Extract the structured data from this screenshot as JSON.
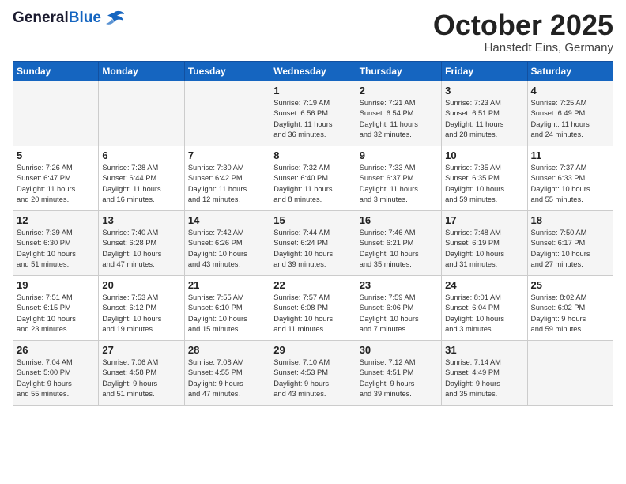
{
  "header": {
    "logo_general": "General",
    "logo_blue": "Blue",
    "month": "October 2025",
    "location": "Hanstedt Eins, Germany"
  },
  "days_of_week": [
    "Sunday",
    "Monday",
    "Tuesday",
    "Wednesday",
    "Thursday",
    "Friday",
    "Saturday"
  ],
  "weeks": [
    [
      {
        "day": "",
        "info": ""
      },
      {
        "day": "",
        "info": ""
      },
      {
        "day": "",
        "info": ""
      },
      {
        "day": "1",
        "info": "Sunrise: 7:19 AM\nSunset: 6:56 PM\nDaylight: 11 hours\nand 36 minutes."
      },
      {
        "day": "2",
        "info": "Sunrise: 7:21 AM\nSunset: 6:54 PM\nDaylight: 11 hours\nand 32 minutes."
      },
      {
        "day": "3",
        "info": "Sunrise: 7:23 AM\nSunset: 6:51 PM\nDaylight: 11 hours\nand 28 minutes."
      },
      {
        "day": "4",
        "info": "Sunrise: 7:25 AM\nSunset: 6:49 PM\nDaylight: 11 hours\nand 24 minutes."
      }
    ],
    [
      {
        "day": "5",
        "info": "Sunrise: 7:26 AM\nSunset: 6:47 PM\nDaylight: 11 hours\nand 20 minutes."
      },
      {
        "day": "6",
        "info": "Sunrise: 7:28 AM\nSunset: 6:44 PM\nDaylight: 11 hours\nand 16 minutes."
      },
      {
        "day": "7",
        "info": "Sunrise: 7:30 AM\nSunset: 6:42 PM\nDaylight: 11 hours\nand 12 minutes."
      },
      {
        "day": "8",
        "info": "Sunrise: 7:32 AM\nSunset: 6:40 PM\nDaylight: 11 hours\nand 8 minutes."
      },
      {
        "day": "9",
        "info": "Sunrise: 7:33 AM\nSunset: 6:37 PM\nDaylight: 11 hours\nand 3 minutes."
      },
      {
        "day": "10",
        "info": "Sunrise: 7:35 AM\nSunset: 6:35 PM\nDaylight: 10 hours\nand 59 minutes."
      },
      {
        "day": "11",
        "info": "Sunrise: 7:37 AM\nSunset: 6:33 PM\nDaylight: 10 hours\nand 55 minutes."
      }
    ],
    [
      {
        "day": "12",
        "info": "Sunrise: 7:39 AM\nSunset: 6:30 PM\nDaylight: 10 hours\nand 51 minutes."
      },
      {
        "day": "13",
        "info": "Sunrise: 7:40 AM\nSunset: 6:28 PM\nDaylight: 10 hours\nand 47 minutes."
      },
      {
        "day": "14",
        "info": "Sunrise: 7:42 AM\nSunset: 6:26 PM\nDaylight: 10 hours\nand 43 minutes."
      },
      {
        "day": "15",
        "info": "Sunrise: 7:44 AM\nSunset: 6:24 PM\nDaylight: 10 hours\nand 39 minutes."
      },
      {
        "day": "16",
        "info": "Sunrise: 7:46 AM\nSunset: 6:21 PM\nDaylight: 10 hours\nand 35 minutes."
      },
      {
        "day": "17",
        "info": "Sunrise: 7:48 AM\nSunset: 6:19 PM\nDaylight: 10 hours\nand 31 minutes."
      },
      {
        "day": "18",
        "info": "Sunrise: 7:50 AM\nSunset: 6:17 PM\nDaylight: 10 hours\nand 27 minutes."
      }
    ],
    [
      {
        "day": "19",
        "info": "Sunrise: 7:51 AM\nSunset: 6:15 PM\nDaylight: 10 hours\nand 23 minutes."
      },
      {
        "day": "20",
        "info": "Sunrise: 7:53 AM\nSunset: 6:12 PM\nDaylight: 10 hours\nand 19 minutes."
      },
      {
        "day": "21",
        "info": "Sunrise: 7:55 AM\nSunset: 6:10 PM\nDaylight: 10 hours\nand 15 minutes."
      },
      {
        "day": "22",
        "info": "Sunrise: 7:57 AM\nSunset: 6:08 PM\nDaylight: 10 hours\nand 11 minutes."
      },
      {
        "day": "23",
        "info": "Sunrise: 7:59 AM\nSunset: 6:06 PM\nDaylight: 10 hours\nand 7 minutes."
      },
      {
        "day": "24",
        "info": "Sunrise: 8:01 AM\nSunset: 6:04 PM\nDaylight: 10 hours\nand 3 minutes."
      },
      {
        "day": "25",
        "info": "Sunrise: 8:02 AM\nSunset: 6:02 PM\nDaylight: 9 hours\nand 59 minutes."
      }
    ],
    [
      {
        "day": "26",
        "info": "Sunrise: 7:04 AM\nSunset: 5:00 PM\nDaylight: 9 hours\nand 55 minutes."
      },
      {
        "day": "27",
        "info": "Sunrise: 7:06 AM\nSunset: 4:58 PM\nDaylight: 9 hours\nand 51 minutes."
      },
      {
        "day": "28",
        "info": "Sunrise: 7:08 AM\nSunset: 4:55 PM\nDaylight: 9 hours\nand 47 minutes."
      },
      {
        "day": "29",
        "info": "Sunrise: 7:10 AM\nSunset: 4:53 PM\nDaylight: 9 hours\nand 43 minutes."
      },
      {
        "day": "30",
        "info": "Sunrise: 7:12 AM\nSunset: 4:51 PM\nDaylight: 9 hours\nand 39 minutes."
      },
      {
        "day": "31",
        "info": "Sunrise: 7:14 AM\nSunset: 4:49 PM\nDaylight: 9 hours\nand 35 minutes."
      },
      {
        "day": "",
        "info": ""
      }
    ]
  ]
}
